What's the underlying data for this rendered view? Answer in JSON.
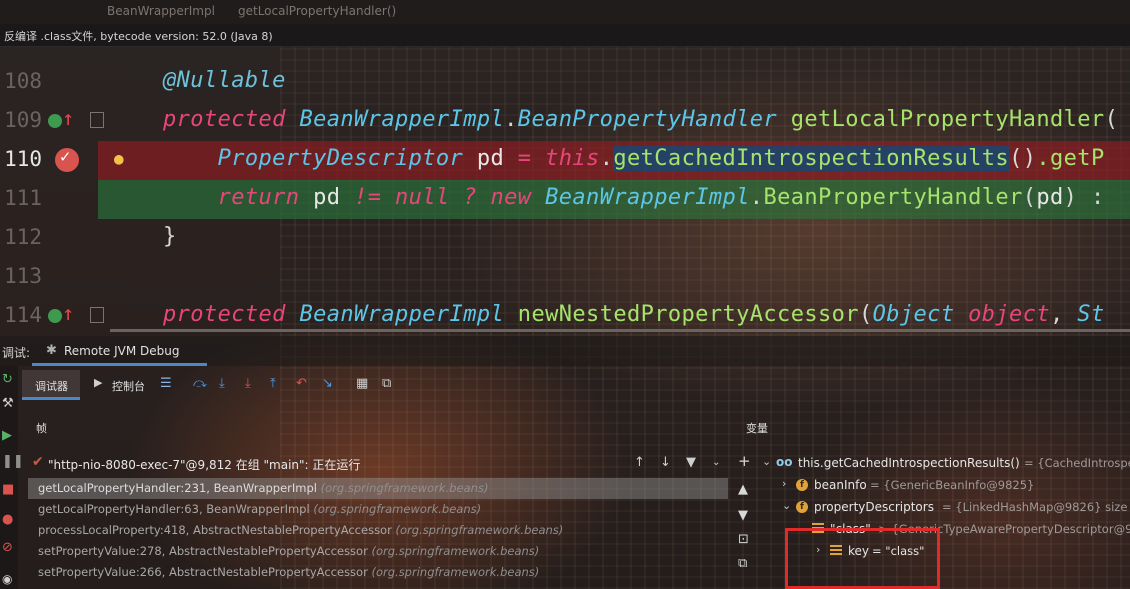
{
  "editor": {
    "tabs": [
      "BeanWrapperImpl",
      "getLocalPropertyHandler()"
    ],
    "banner": "反编译 .class文件, bytecode version: 52.0 (Java 8)",
    "lines": [
      {
        "num": "108",
        "parts": [
          {
            "t": "@Nullable",
            "c": "an"
          }
        ]
      },
      {
        "num": "109",
        "parts": [
          {
            "t": "protected ",
            "c": "kw"
          },
          {
            "t": "BeanWrapperImpl",
            "c": "ty"
          },
          {
            "t": ".",
            "c": "pu"
          },
          {
            "t": "BeanPropertyHandler",
            "c": "ty"
          },
          {
            "t": " ",
            "c": "pl"
          },
          {
            "t": "getLocalPropertyHandler",
            "c": "fn"
          },
          {
            "t": "(",
            "c": "pu"
          }
        ]
      },
      {
        "num": "110",
        "parts": [
          {
            "t": "    PropertyDescriptor",
            "c": "ty"
          },
          {
            "t": " pd ",
            "c": "pl"
          },
          {
            "t": "= ",
            "c": "kw"
          },
          {
            "t": "this",
            "c": "kw"
          },
          {
            "t": ".",
            "c": "pu"
          },
          {
            "t": "getCachedIntrospectionResults",
            "c": "fn sel"
          },
          {
            "t": "()",
            "c": "pu"
          },
          {
            "t": ".getP",
            "c": "fn"
          }
        ]
      },
      {
        "num": "111",
        "parts": [
          {
            "t": "    return",
            "c": "kw"
          },
          {
            "t": " pd ",
            "c": "pl"
          },
          {
            "t": "!= ",
            "c": "kw"
          },
          {
            "t": "null ",
            "c": "kw"
          },
          {
            "t": "? ",
            "c": "kw"
          },
          {
            "t": "new ",
            "c": "kw"
          },
          {
            "t": "BeanWrapperImpl",
            "c": "ty"
          },
          {
            "t": ".",
            "c": "pu"
          },
          {
            "t": "BeanPropertyHandler",
            "c": "fn"
          },
          {
            "t": "(",
            "c": "pu"
          },
          {
            "t": "pd",
            "c": "pl"
          },
          {
            "t": ") :",
            "c": "pu"
          }
        ]
      },
      {
        "num": "112",
        "parts": [
          {
            "t": "}",
            "c": "pu"
          }
        ]
      },
      {
        "num": "113",
        "parts": []
      },
      {
        "num": "114",
        "parts": [
          {
            "t": "protected ",
            "c": "kw"
          },
          {
            "t": "BeanWrapperImpl",
            "c": "ty"
          },
          {
            "t": " ",
            "c": "pl"
          },
          {
            "t": "newNestedPropertyAccessor",
            "c": "fn"
          },
          {
            "t": "(",
            "c": "pu"
          },
          {
            "t": "Object ",
            "c": "ty"
          },
          {
            "t": "object",
            "c": "kw"
          },
          {
            "t": ", ",
            "c": "pu"
          },
          {
            "t": "St",
            "c": "ty"
          }
        ]
      }
    ]
  },
  "debug": {
    "panel_label": "调试:",
    "run_tab": "Remote JVM Debug",
    "toolbar": {
      "debugger_tab": "调试器",
      "console_tab": "控制台"
    },
    "frames_header": "帧",
    "variables_header": "变量",
    "thread": "\"http-nio-8080-exec-7\"@9,812 在组 \"main\": 正在运行",
    "frames": [
      {
        "method": "getLocalPropertyHandler:231, BeanWrapperImpl",
        "pkg": "(org.springframework.beans)"
      },
      {
        "method": "getLocalPropertyHandler:63, BeanWrapperImpl",
        "pkg": "(org.springframework.beans)"
      },
      {
        "method": "processLocalProperty:418, AbstractNestablePropertyAccessor",
        "pkg": "(org.springframework.beans)"
      },
      {
        "method": "setPropertyValue:278, AbstractNestablePropertyAccessor",
        "pkg": "(org.springframework.beans)"
      },
      {
        "method": "setPropertyValue:266, AbstractNestablePropertyAccessor",
        "pkg": "(org.springframework.beans)"
      }
    ],
    "variables": {
      "root": {
        "name": "this.getCachedIntrospectionResults()",
        "value": "= {CachedIntrospect"
      },
      "bean_info": {
        "name": "beanInfo",
        "value": "= {GenericBeanInfo@9825}"
      },
      "property_descriptors": {
        "name": "propertyDescriptors",
        "value": "= {LinkedHashMap@9826}  size"
      },
      "class_entry": {
        "name": "\"class\"",
        "value": "-> {GenericTypeAwarePropertyDescriptor@9"
      },
      "key_entry": {
        "name": "key",
        "value": "= \"class\""
      }
    }
  },
  "colors": {
    "accent": "#4a88c7",
    "highlight_box": "#e12b2b",
    "breakpoint_line": "#961c22",
    "exec_line": "#28783c"
  }
}
